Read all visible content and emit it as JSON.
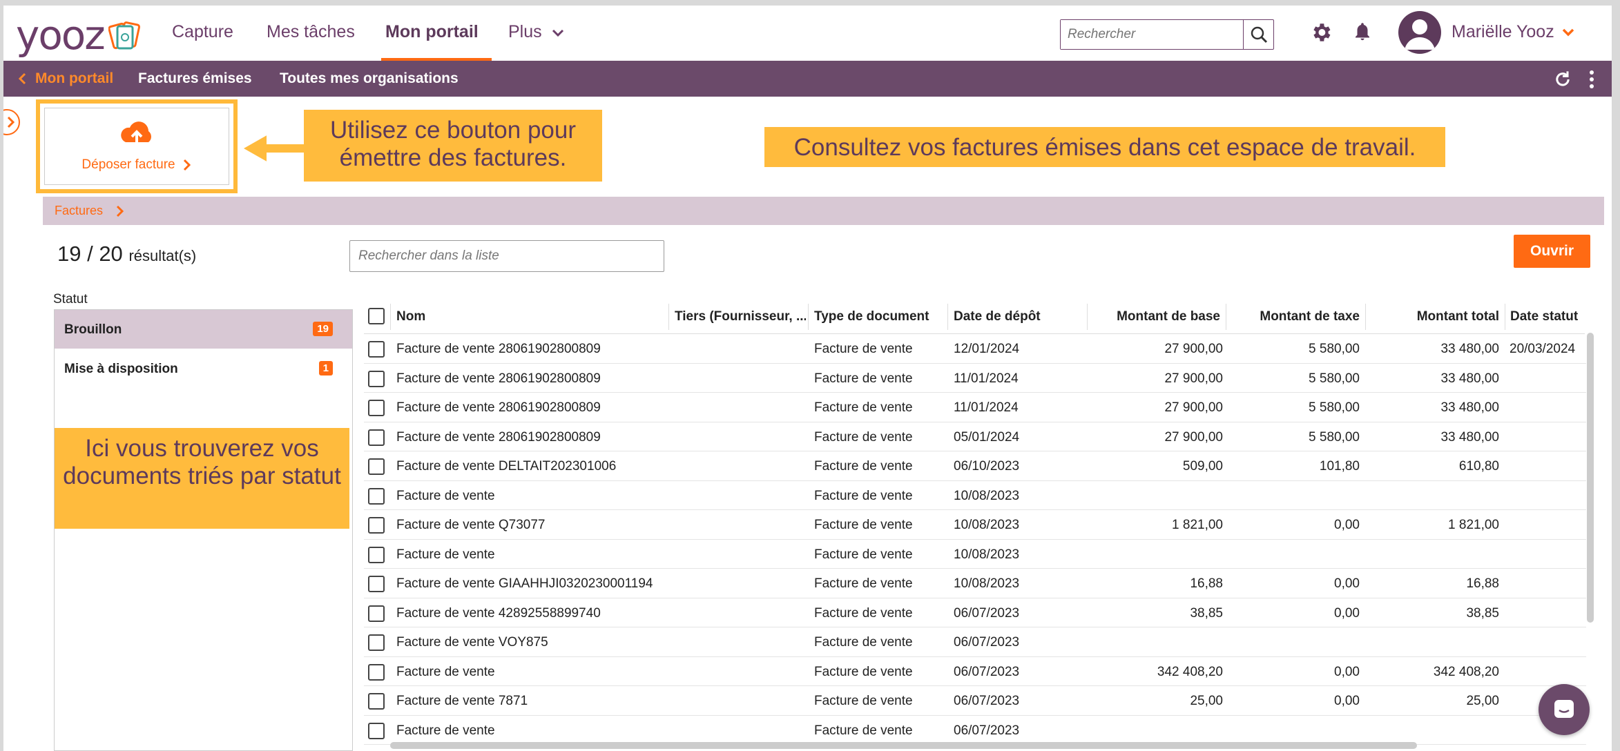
{
  "brand": {
    "logo_text": "yooz",
    "accent": "#ff6a13",
    "purple": "#6b4a6a",
    "highlight": "#ffbb3d"
  },
  "topnav": {
    "items": [
      {
        "label": "Capture"
      },
      {
        "label": "Mes tâches"
      },
      {
        "label": "Mon portail",
        "active": true
      },
      {
        "label": "Plus"
      }
    ],
    "search_placeholder": "Rechercher",
    "user_name": "Mariëlle Yooz"
  },
  "subnav": {
    "back_label": "Mon portail",
    "items": [
      {
        "label": "Factures émises"
      },
      {
        "label": "Toutes mes organisations"
      }
    ]
  },
  "deposit": {
    "label": "Déposer facture"
  },
  "tips": {
    "button_tip": "Utilisez ce bouton pour émettre des factures.",
    "workspace_tip": "Consultez vos factures émises dans cet espace de travail.",
    "status_tip": "Ici vous trouverez vos documents triés par statut"
  },
  "breadcrumb": {
    "label": "Factures"
  },
  "results": {
    "count": "19 / 20",
    "suffix": "résultat(s)"
  },
  "list_search_placeholder": "Rechercher dans la liste",
  "open_button": "Ouvrir",
  "status": {
    "label": "Statut",
    "items": [
      {
        "label": "Brouillon",
        "count": "19",
        "selected": true
      },
      {
        "label": "Mise à disposition",
        "count": "1",
        "selected": false
      }
    ]
  },
  "table": {
    "columns": [
      "Nom",
      "Tiers (Fournisseur, ...",
      "Type de document",
      "Date de dépôt",
      "Montant de base",
      "Montant de taxe",
      "Montant total",
      "Date statut"
    ],
    "rows": [
      {
        "nom": "Facture de vente 28061902800809",
        "tiers": "",
        "type": "Facture de vente",
        "date": "12/01/2024",
        "base": "27 900,00",
        "taxe": "5 580,00",
        "total": "33 480,00",
        "statut": "20/03/2024"
      },
      {
        "nom": "Facture de vente 28061902800809",
        "tiers": "",
        "type": "Facture de vente",
        "date": "11/01/2024",
        "base": "27 900,00",
        "taxe": "5 580,00",
        "total": "33 480,00",
        "statut": ""
      },
      {
        "nom": "Facture de vente 28061902800809",
        "tiers": "",
        "type": "Facture de vente",
        "date": "11/01/2024",
        "base": "27 900,00",
        "taxe": "5 580,00",
        "total": "33 480,00",
        "statut": ""
      },
      {
        "nom": "Facture de vente 28061902800809",
        "tiers": "",
        "type": "Facture de vente",
        "date": "05/01/2024",
        "base": "27 900,00",
        "taxe": "5 580,00",
        "total": "33 480,00",
        "statut": ""
      },
      {
        "nom": "Facture de vente DELTAIT202301006",
        "tiers": "",
        "type": "Facture de vente",
        "date": "06/10/2023",
        "base": "509,00",
        "taxe": "101,80",
        "total": "610,80",
        "statut": ""
      },
      {
        "nom": "Facture de vente",
        "tiers": "",
        "type": "Facture de vente",
        "date": "10/08/2023",
        "base": "",
        "taxe": "",
        "total": "",
        "statut": ""
      },
      {
        "nom": "Facture de vente Q73077",
        "tiers": "",
        "type": "Facture de vente",
        "date": "10/08/2023",
        "base": "1 821,00",
        "taxe": "0,00",
        "total": "1 821,00",
        "statut": ""
      },
      {
        "nom": "Facture de vente",
        "tiers": "",
        "type": "Facture de vente",
        "date": "10/08/2023",
        "base": "",
        "taxe": "",
        "total": "",
        "statut": ""
      },
      {
        "nom": "Facture de vente GIAAHHJI0320230001194",
        "tiers": "",
        "type": "Facture de vente",
        "date": "10/08/2023",
        "base": "16,88",
        "taxe": "0,00",
        "total": "16,88",
        "statut": ""
      },
      {
        "nom": "Facture de vente 42892558899740",
        "tiers": "",
        "type": "Facture de vente",
        "date": "06/07/2023",
        "base": "38,85",
        "taxe": "0,00",
        "total": "38,85",
        "statut": ""
      },
      {
        "nom": "Facture de vente VOY875",
        "tiers": "",
        "type": "Facture de vente",
        "date": "06/07/2023",
        "base": "",
        "taxe": "",
        "total": "",
        "statut": ""
      },
      {
        "nom": "Facture de vente",
        "tiers": "",
        "type": "Facture de vente",
        "date": "06/07/2023",
        "base": "342 408,20",
        "taxe": "0,00",
        "total": "342 408,20",
        "statut": ""
      },
      {
        "nom": "Facture de vente 7871",
        "tiers": "",
        "type": "Facture de vente",
        "date": "06/07/2023",
        "base": "25,00",
        "taxe": "0,00",
        "total": "25,00",
        "statut": ""
      },
      {
        "nom": "Facture de vente",
        "tiers": "",
        "type": "Facture de vente",
        "date": "06/07/2023",
        "base": "",
        "taxe": "",
        "total": "",
        "statut": ""
      }
    ]
  }
}
